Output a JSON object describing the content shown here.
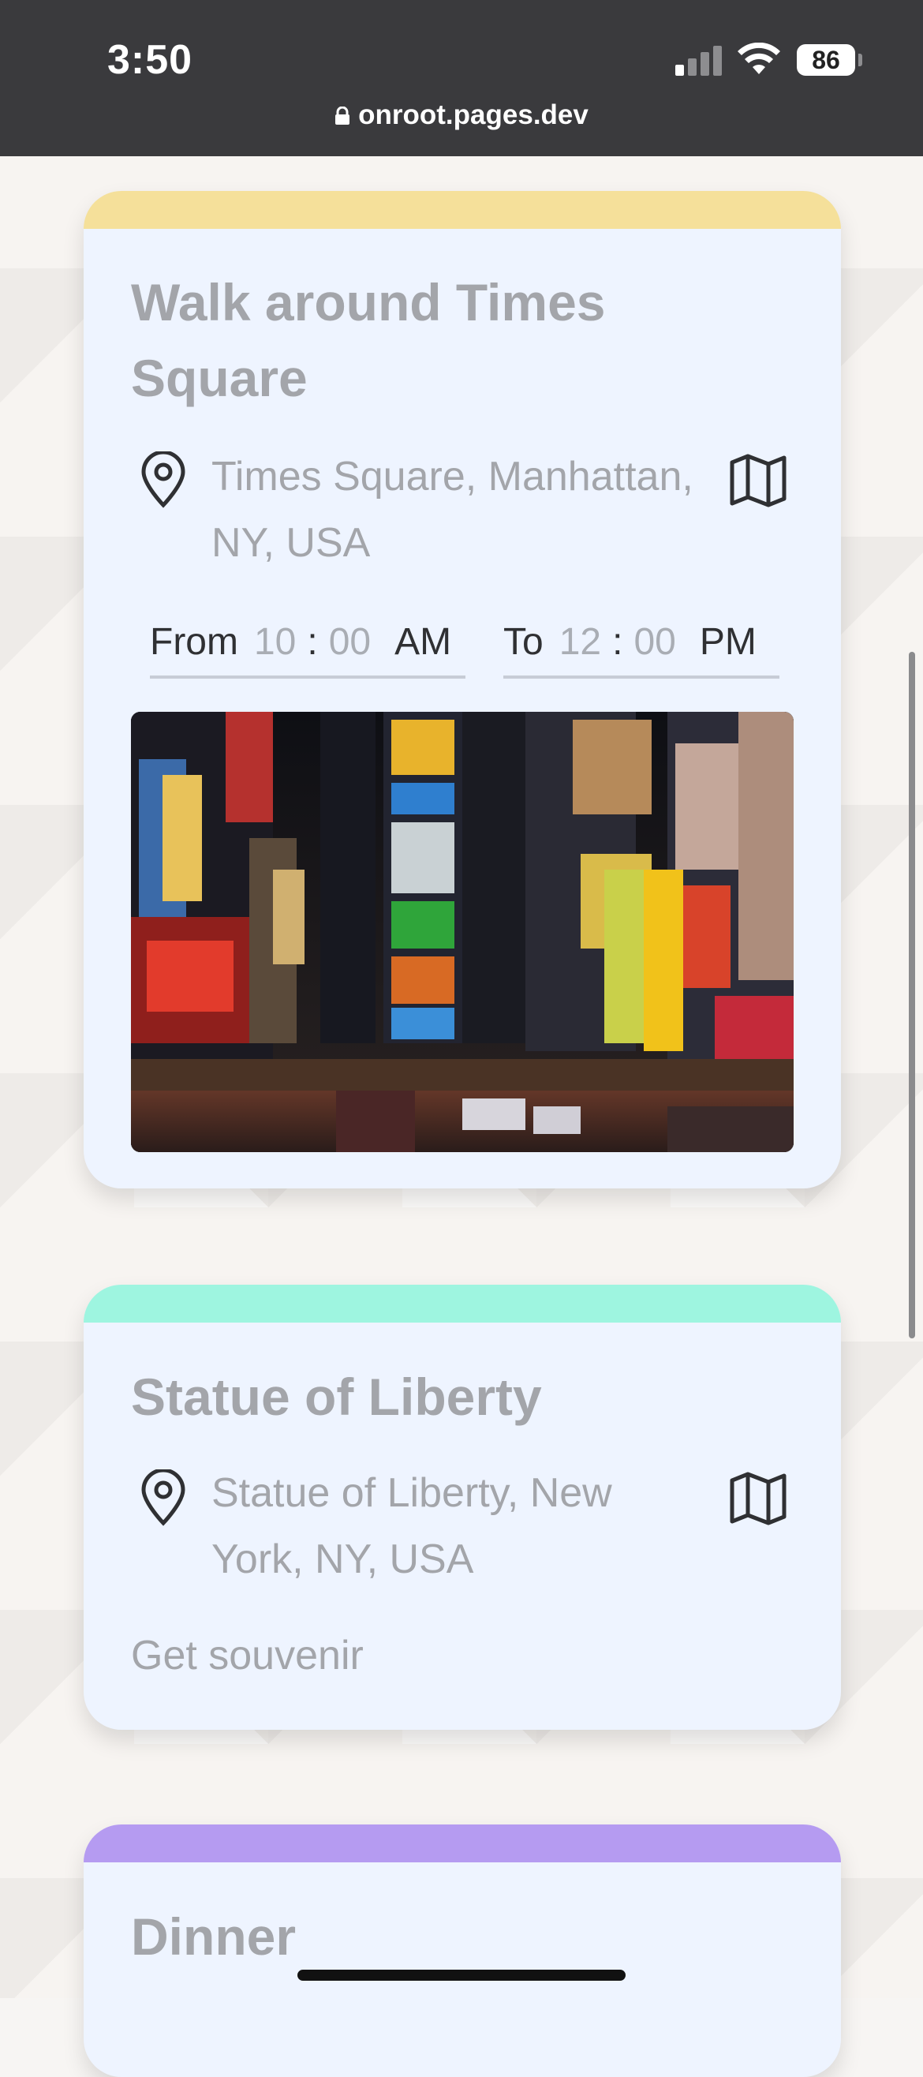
{
  "status_bar": {
    "time": "3:50",
    "battery": "86",
    "url": "onroot.pages.dev"
  },
  "cards": [
    {
      "title": "Walk around Times Square",
      "band_color": "#f5e09a",
      "address": "Times Square, Manhattan, NY, USA",
      "pin_icon": "location-pin-icon",
      "map_icon": "map-icon",
      "time": {
        "from_label": "From",
        "from_hour": "10",
        "from_min": "00",
        "from_ampm": "AM",
        "to_label": "To",
        "to_hour": "12",
        "to_min": "00",
        "to_ampm": "PM",
        "separator": ":"
      }
    },
    {
      "title": "Statue of Liberty",
      "band_color": "#9ef5e0",
      "address": "Statue of Liberty, New York, NY, USA",
      "note": "Get souvenir"
    },
    {
      "title": "Dinner",
      "band_color": "#b59bf1"
    }
  ]
}
